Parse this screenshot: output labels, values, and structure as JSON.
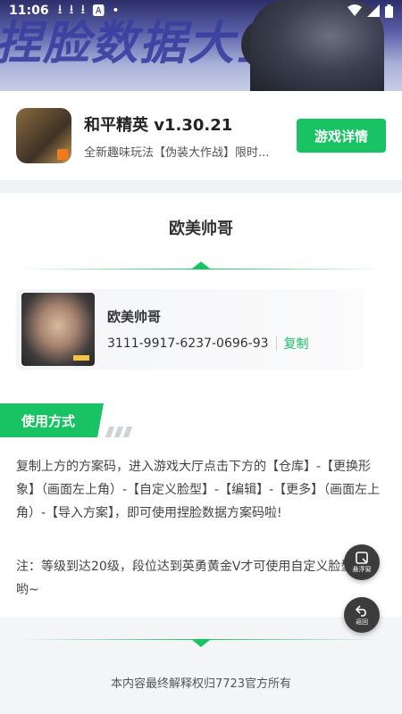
{
  "status_bar": {
    "time": "11:06"
  },
  "banner": {
    "text": "捏脸数据大全"
  },
  "app": {
    "name": "和平精英 v1.30.21",
    "description": "全新趣味玩法【伪装大作战】限时...",
    "detail_button": "游戏详情"
  },
  "section": {
    "title": "欧美帅哥"
  },
  "preset": {
    "name": "欧美帅哥",
    "code": "3111-9917-6237-0696-93",
    "copy_label": "复制"
  },
  "usage": {
    "tag": "使用方式",
    "instructions": "复制上方的方案码，进入游戏大厅点击下方的【仓库】-【更换形象】（画面左上角）-【自定义脸型】-【编辑】-【更多】（画面左上角）-【导入方案】，即可使用捏脸数据方案码啦!",
    "note": "注：等级到达20级，段位达到英勇黄金V才可使用自定义脸型功能哟~"
  },
  "floating": {
    "window_label": "悬浮窗",
    "back_label": "返回"
  },
  "footer": {
    "text": "本内容最终解释权归7723官方所有"
  },
  "colors": {
    "accent": "#19c262"
  }
}
